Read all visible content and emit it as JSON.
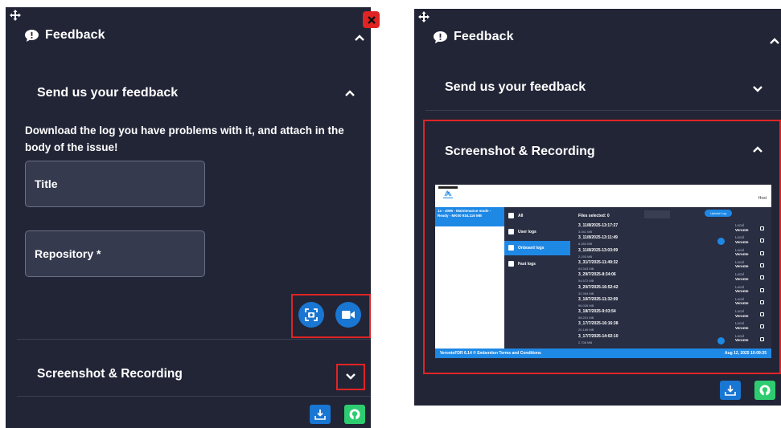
{
  "left_panel": {
    "title": "Feedback",
    "send_section_title": "Send us your feedback",
    "description": "Download the log you have problems with it, and attach in the body of the issue!",
    "title_field": {
      "placeholder": "Title",
      "value": ""
    },
    "repository_field": {
      "placeholder": "Repository *",
      "value": ""
    },
    "screenshot_section_title": "Screenshot & Recording"
  },
  "right_panel": {
    "title": "Feedback",
    "send_section_title": "Send us your feedback",
    "screenshot_section_title": "Screenshot & Recording"
  },
  "preview": {
    "host_label": "Host",
    "status_text": "1x - 4096 - Maintenance mode - Ready - MK00 934.116 MB",
    "nav": [
      "All",
      "User logs",
      "Onboard logs",
      "Fast logs"
    ],
    "files_selected": "Files selected: 0",
    "upload_label": "Upload Log",
    "rows": [
      {
        "name": "3_11/8/2025-13:17:27",
        "size": "3.041 MB",
        "status_a": "Local",
        "status_b": "Veronte"
      },
      {
        "name": "3_11/8/2025-13:11:49",
        "size": "8.283 MB",
        "status_a": "Local",
        "status_b": "Veronte"
      },
      {
        "name": "3_11/8/2025-13:03:09",
        "size": "2.193 MB",
        "status_a": "Local",
        "status_b": "Veronte"
      },
      {
        "name": "3_31/7/2025-11:49:32",
        "size": "63.343 MB",
        "status_a": "Local",
        "status_b": "Veronte"
      },
      {
        "name": "3_29/7/2025-8:34:06",
        "size": "54.572 MB",
        "status_a": "Local",
        "status_b": "Veronte"
      },
      {
        "name": "3_20/7/2025-16:52:42",
        "size": "32.394 MB",
        "status_a": "Local",
        "status_b": "Veronte"
      },
      {
        "name": "3_10/7/2025-11:32:09",
        "size": "96.026 MB",
        "status_a": "Local",
        "status_b": "Veronte"
      },
      {
        "name": "3_18/7/2025-9:03:54",
        "size": "58.201 MB",
        "status_a": "Local",
        "status_b": "Veronte"
      },
      {
        "name": "3_17/7/2025-16:16:38",
        "size": "20.189 MB",
        "status_a": "Local",
        "status_b": "Veronte"
      },
      {
        "name": "3_17/7/2025-14:02:10",
        "size": "2.706 MB",
        "status_a": "Local",
        "status_b": "Veronte"
      }
    ],
    "footer_left": "VeronteFDR 6.14 © Embention  Terms and Conditions",
    "footer_right": "Aug 12, 2025   10:09:35"
  },
  "colors": {
    "panel_bg": "#222536",
    "accent_blue": "#1976d2",
    "github_green": "#2ecc71",
    "close_red": "#e02424",
    "highlight_red": "#e02424"
  },
  "icons": [
    "move-icon",
    "feedback-bubble-icon",
    "close-icon",
    "chevron-up-icon",
    "chevron-down-icon",
    "screenshot-icon",
    "video-camera-icon",
    "download-icon",
    "github-icon"
  ]
}
